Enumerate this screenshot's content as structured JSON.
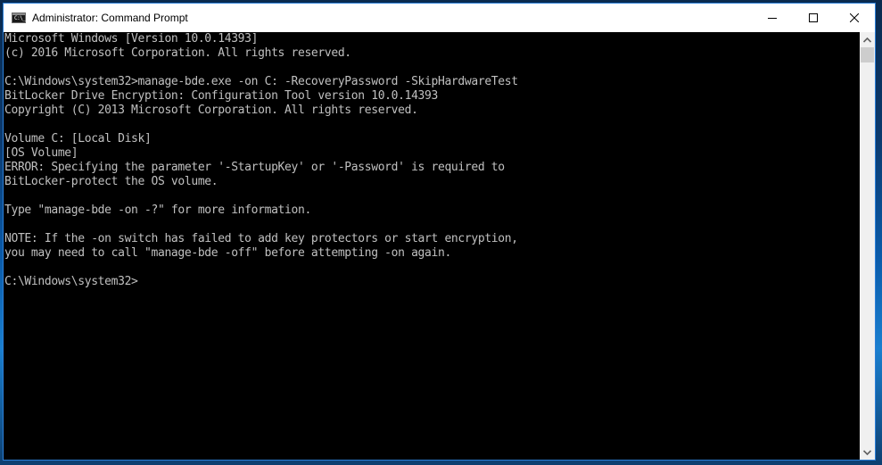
{
  "window": {
    "title": "Administrator: Command Prompt",
    "icon": "cmd-icon",
    "icon_text": "C:\\_",
    "controls": {
      "minimize": "minimize-icon",
      "maximize": "maximize-icon",
      "close": "close-icon"
    }
  },
  "console": {
    "text_color": "#c0c0c0",
    "background": "#000000",
    "lines": [
      "Microsoft Windows [Version 10.0.14393]",
      "(c) 2016 Microsoft Corporation. All rights reserved.",
      "",
      "C:\\Windows\\system32>manage-bde.exe -on C: -RecoveryPassword -SkipHardwareTest",
      "BitLocker Drive Encryption: Configuration Tool version 10.0.14393",
      "Copyright (C) 2013 Microsoft Corporation. All rights reserved.",
      "",
      "Volume C: [Local Disk]",
      "[OS Volume]",
      "ERROR: Specifying the parameter '-StartupKey' or '-Password' is required to",
      "BitLocker-protect the OS volume.",
      "",
      "Type \"manage-bde -on -?\" for more information.",
      "",
      "NOTE: If the -on switch has failed to add key protectors or start encryption,",
      "you may need to call \"manage-bde -off\" before attempting -on again.",
      "",
      "C:\\Windows\\system32>"
    ]
  },
  "scrollbar": {
    "up_icon": "chevron-up-icon",
    "down_icon": "chevron-down-icon",
    "position": 0
  }
}
